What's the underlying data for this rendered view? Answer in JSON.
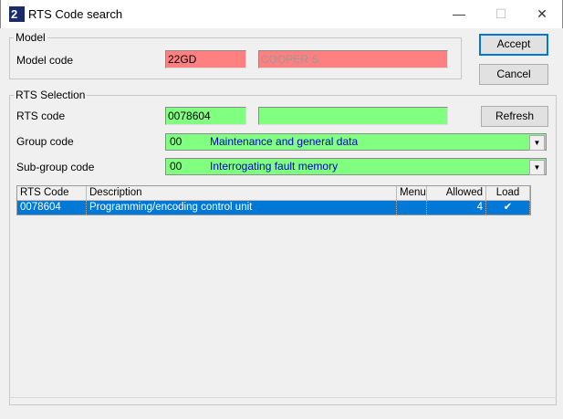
{
  "window": {
    "title": "RTS Code search",
    "minimize": "—",
    "maximize": "☐",
    "close": "✕"
  },
  "model": {
    "group_label": "Model",
    "model_code_label": "Model code",
    "model_code": "22GD",
    "model_name": "COOPER S"
  },
  "buttons": {
    "accept": "Accept",
    "cancel": "Cancel",
    "refresh": "Refresh"
  },
  "rts": {
    "group_label": "RTS Selection",
    "rts_code_label": "RTS code",
    "rts_code": "0078604",
    "rts_extra": "",
    "group_code_label": "Group code",
    "group_code": "00",
    "group_desc": "Maintenance and general data",
    "subgroup_code_label": "Sub-group code",
    "subgroup_code": "00",
    "subgroup_desc": "Interrogating fault memory"
  },
  "table": {
    "headers": [
      "RTS Code",
      "Description",
      "Menu",
      "Allowed",
      "Load"
    ],
    "rows": [
      {
        "rts_code": "0078604",
        "description": "Programming/encoding control unit",
        "menu": "",
        "allowed": "4",
        "load": "✔"
      }
    ]
  },
  "colors": {
    "red_field": "#ff8080",
    "green_field": "#80ff80",
    "selection": "#0078d7"
  }
}
